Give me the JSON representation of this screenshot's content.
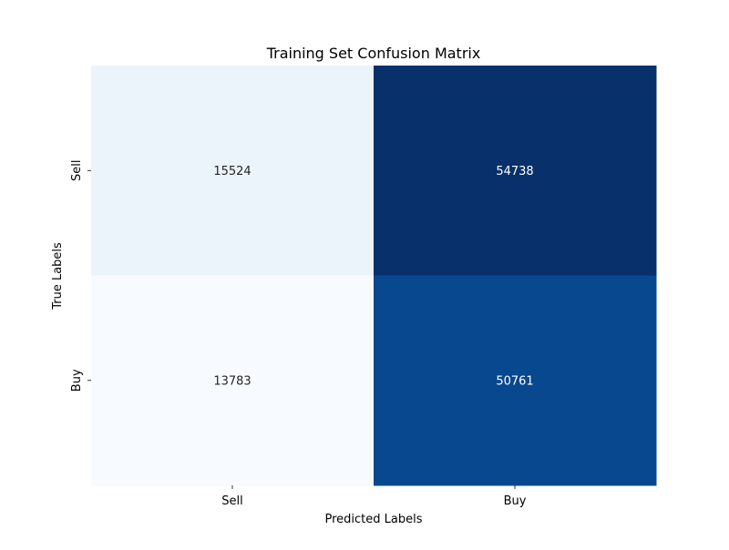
{
  "chart_data": {
    "type": "heatmap",
    "title": "Training Set Confusion Matrix",
    "xlabel": "Predicted Labels",
    "ylabel": "True Labels",
    "x_categories": [
      "Sell",
      "Buy"
    ],
    "y_categories": [
      "Sell",
      "Buy"
    ],
    "values": [
      [
        15524,
        54738
      ],
      [
        13783,
        50761
      ]
    ],
    "colormap": "Blues",
    "colorbar": false,
    "cell_colors": [
      [
        "#ebf3fb",
        "#08306b"
      ],
      [
        "#f7fbff",
        "#08488e"
      ]
    ],
    "annotation_colors": [
      [
        "#262626",
        "#ffffff"
      ],
      [
        "#262626",
        "#ffffff"
      ]
    ]
  }
}
